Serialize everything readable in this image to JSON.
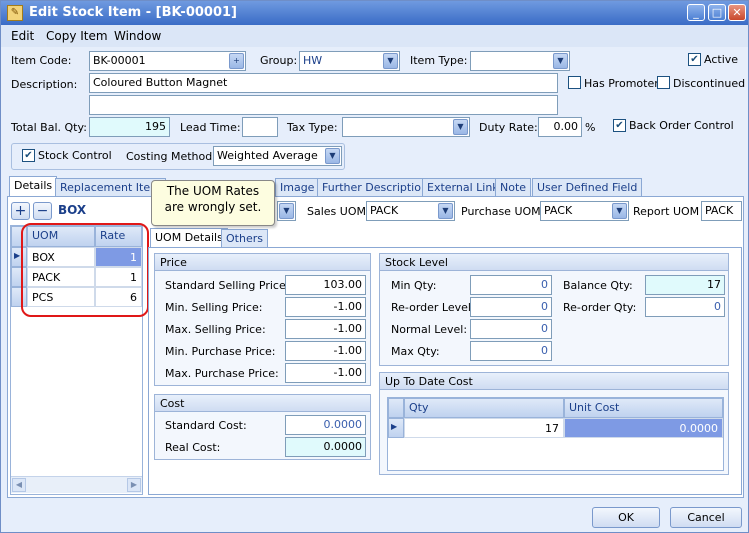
{
  "window": {
    "title": "Edit Stock Item - [BK-00001]",
    "min": "_",
    "max": "□",
    "close": "✕"
  },
  "menu": {
    "edit": "Edit",
    "copy_item": "Copy Item",
    "window": "Window"
  },
  "form": {
    "item_code_label": "Item Code:",
    "item_code": "BK-00001",
    "group_label": "Group:",
    "group": "HW",
    "item_type_label": "Item Type:",
    "item_type": "",
    "active_label": "Active",
    "description_label": "Description:",
    "description": "Coloured Button Magnet",
    "description2": "",
    "has_promoter_label": "Has Promoter",
    "discontinued_label": "Discontinued",
    "total_bal_qty_label": "Total Bal. Qty:",
    "total_bal_qty": "195",
    "lead_time_label": "Lead Time:",
    "lead_time": "",
    "tax_type_label": "Tax Type:",
    "tax_type": "",
    "duty_rate_label": "Duty Rate:",
    "duty_rate": "0.00",
    "duty_rate_unit": "%",
    "back_order_label": "Back Order Control",
    "stock_control_label": "Stock Control",
    "costing_method_label": "Costing Method:",
    "costing_method": "Weighted Average"
  },
  "tabs": [
    "Details",
    "Replacement Item",
    "Image",
    "Further Description",
    "External Link",
    "Note",
    "User Defined Field"
  ],
  "uom_bar": {
    "base_uom": "BOX",
    "sales_uom_label": "Sales UOM",
    "sales_uom": "PACK",
    "purchase_uom_label": "Purchase UOM",
    "purchase_uom": "PACK",
    "report_uom_label": "Report UOM",
    "report_uom": "PACK"
  },
  "uom_grid": {
    "headers": [
      "UOM",
      "Rate"
    ],
    "rows": [
      {
        "uom": "BOX",
        "rate": "1"
      },
      {
        "uom": "PACK",
        "rate": "1"
      },
      {
        "uom": "PCS",
        "rate": "6"
      }
    ]
  },
  "callout": "The UOM Rates are wrongly set.",
  "sub_tabs": [
    "UOM Details",
    "Others"
  ],
  "price": {
    "title": "Price",
    "standard_selling_label": "Standard Selling Price:",
    "standard_selling": "103.00",
    "min_selling_label": "Min. Selling Price:",
    "min_selling": "-1.00",
    "max_selling_label": "Max. Selling Price:",
    "max_selling": "-1.00",
    "min_purchase_label": "Min. Purchase Price:",
    "min_purchase": "-1.00",
    "max_purchase_label": "Max. Purchase Price:",
    "max_purchase": "-1.00"
  },
  "cost": {
    "title": "Cost",
    "standard_label": "Standard Cost:",
    "standard": "0.0000",
    "real_label": "Real Cost:",
    "real": "0.0000"
  },
  "stock_level": {
    "title": "Stock Level",
    "min_qty_label": "Min Qty:",
    "min_qty": "0",
    "reorder_level_label": "Re-order Level:",
    "reorder_level": "0",
    "normal_level_label": "Normal Level:",
    "normal_level": "0",
    "max_qty_label": "Max Qty:",
    "max_qty": "0",
    "balance_qty_label": "Balance Qty:",
    "balance_qty": "17",
    "reorder_qty_label": "Re-order Qty:",
    "reorder_qty": "0"
  },
  "up_to_date": {
    "title": "Up To Date Cost",
    "headers": [
      "Qty",
      "Unit Cost"
    ],
    "qty": "17",
    "unit_cost": "0.0000"
  },
  "buttons": {
    "ok": "OK",
    "cancel": "Cancel"
  }
}
